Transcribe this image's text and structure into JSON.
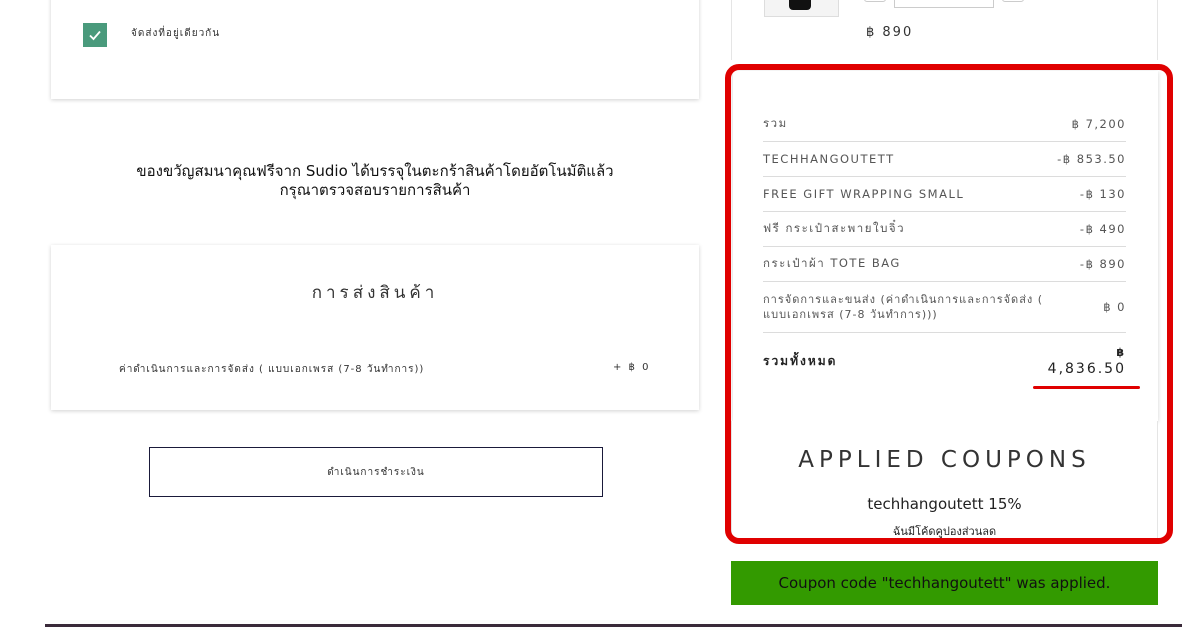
{
  "shipping_address": {
    "same_address_label": "จัดส่งที่อยู่เดียวกัน",
    "same_address_checked": true
  },
  "gift_message": {
    "line1": "ของขวัญสมนาคุณฟรีจาก Sudio ได้บรรจุในตะกร้าสินค้าโดยอัตโนมัติแล้ว",
    "line2": "กรุณาตรวจสอบรายการสินค้า"
  },
  "shipping": {
    "heading": "การส่งสินค้า",
    "method_label": "ค่าดำเนินการและการจัดส่ง ( แบบเอกเพรส (7-8 วันทำการ))",
    "method_value": "+ ฿ 0"
  },
  "checkout_button": {
    "label": "ดำเนินการชำระเงิน"
  },
  "cart_item": {
    "price": "฿ 890"
  },
  "summary": {
    "rows": [
      {
        "label": "รวม",
        "value": "฿ 7,200"
      },
      {
        "label": "TECHHANGOUTETT",
        "value": "-฿ 853.50"
      },
      {
        "label": "FREE GIFT WRAPPING SMALL",
        "value": "-฿ 130"
      },
      {
        "label": "ฟรี กระเป๋าสะพายใบจิ๋ว",
        "value": "-฿ 490"
      },
      {
        "label": "กระเป๋าผ้า TOTE BAG",
        "value": "-฿ 890"
      },
      {
        "label": "การจัดการและขนส่ง (ค่าดำเนินการและการจัดส่ง ( แบบเอกเพรส (7-8 วันทำการ)))",
        "value": "฿ 0"
      }
    ],
    "total_label": "รวมทั้งหมด",
    "total_currency": "฿",
    "total_value": "4,836.50"
  },
  "coupons": {
    "heading": "APPLIED COUPONS",
    "coupon_line": "techhangoutett 15%",
    "have_code_link": "ฉันมีโค้ดคูปองส่วนลด"
  },
  "notice": {
    "text": "Coupon code \"techhangoutett\" was applied."
  },
  "colors": {
    "accent_green": "#339a00",
    "checkbox_green": "#4a9a7c",
    "highlight_red": "#e00000"
  }
}
